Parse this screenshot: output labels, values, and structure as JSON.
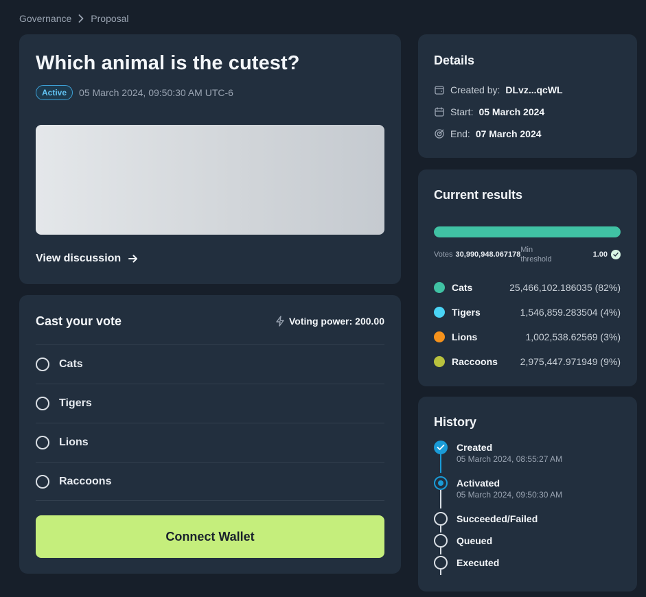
{
  "breadcrumb": {
    "items": [
      "Governance",
      "Proposal"
    ],
    "separator": ">"
  },
  "proposal": {
    "title": "Which animal is the cutest?",
    "status": "Active",
    "date": "05 March 2024, 09:50:30 AM UTC-6",
    "view_discussion": "View discussion"
  },
  "vote": {
    "title": "Cast your vote",
    "voting_power": "Voting power: 200.00",
    "options": [
      "Cats",
      "Tigers",
      "Lions",
      "Raccoons"
    ],
    "connect_label": "Connect Wallet"
  },
  "details": {
    "title": "Details",
    "created_label": "Created by:",
    "created_value": "DLvz...qcWL",
    "start_label": "Start:",
    "start_value": "05 March 2024",
    "end_label": "End:",
    "end_value": "07 March 2024"
  },
  "results": {
    "title": "Current results",
    "votes_label": "Votes",
    "votes_value": "30,990,948.067178",
    "threshold_label": "Min threshold",
    "threshold_value": "1.00",
    "bar_progress": 1.0,
    "items": [
      {
        "name": "Cats",
        "value": "25,466,102.186035 (82%)",
        "color": "#40c2a4"
      },
      {
        "name": "Tigers",
        "value": "1,546,859.283504 (4%)",
        "color": "#4ad4f5"
      },
      {
        "name": "Lions",
        "value": "1,002,538.62569 (3%)",
        "color": "#f5921c"
      },
      {
        "name": "Raccoons",
        "value": "2,975,447.971949 (9%)",
        "color": "#b9c23e"
      }
    ]
  },
  "history": {
    "title": "History",
    "items": [
      {
        "label": "Created",
        "date": "05 March 2024, 08:55:27 AM",
        "state": "done"
      },
      {
        "label": "Activated",
        "date": "05 March 2024, 09:50:30 AM",
        "state": "active"
      },
      {
        "label": "Succeeded/Failed",
        "date": "",
        "state": "pending"
      },
      {
        "label": "Queued",
        "date": "",
        "state": "pending"
      },
      {
        "label": "Executed",
        "date": "",
        "state": "pending"
      }
    ]
  },
  "colors": {
    "background": "#171f2a",
    "card": "#222f3e",
    "accent_green": "#c5ee7c",
    "accent_blue": "#1a9bd7"
  }
}
